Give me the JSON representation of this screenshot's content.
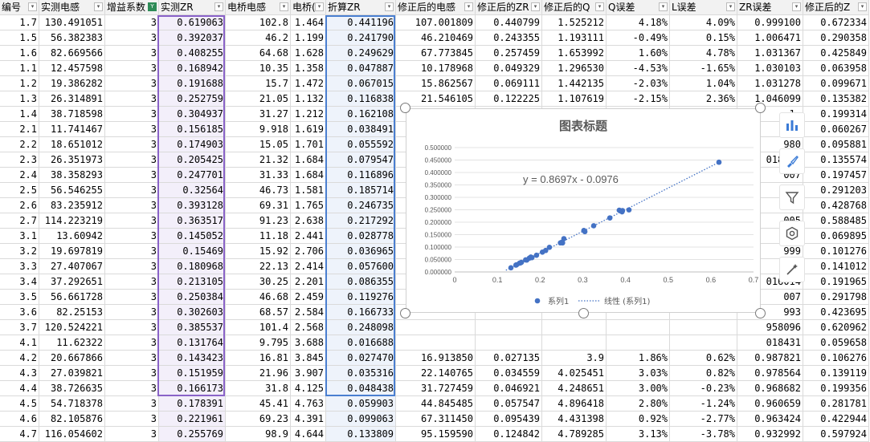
{
  "columns": [
    {
      "label": "编号",
      "filter": false
    },
    {
      "label": "实测电感",
      "filter": false
    },
    {
      "label": "增益系数",
      "filter": true
    },
    {
      "label": "实测ZR",
      "filter": false
    },
    {
      "label": "电桥电感",
      "filter": false
    },
    {
      "label": "电桥(",
      "filter": false
    },
    {
      "label": "折算ZR",
      "filter": false
    },
    {
      "label": "修正后的电感",
      "filter": false
    },
    {
      "label": "修正后的ZR",
      "filter": false
    },
    {
      "label": "修正后的Q",
      "filter": false
    },
    {
      "label": "Q误差",
      "filter": false
    },
    {
      "label": "L误差",
      "filter": false
    },
    {
      "label": "ZR误差",
      "filter": false
    },
    {
      "label": "修正后的Z",
      "filter": false
    }
  ],
  "rows": [
    [
      "1.7",
      "130.491051",
      "3",
      "0.619063",
      "102.8",
      "1.464",
      "0.441196",
      "107.001809",
      "0.440799",
      "1.525212",
      "4.18%",
      "4.09%",
      "0.999100",
      "0.672334"
    ],
    [
      "1.5",
      "56.382383",
      "3",
      "0.392037",
      "46.2",
      "1.199",
      "0.241790",
      "46.210469",
      "0.243355",
      "1.193111",
      "-0.49%",
      "0.15%",
      "1.006471",
      "0.290358"
    ],
    [
      "1.6",
      "82.669566",
      "3",
      "0.408255",
      "64.68",
      "1.628",
      "0.249629",
      "67.773845",
      "0.257459",
      "1.653992",
      "1.60%",
      "4.78%",
      "1.031367",
      "0.425849"
    ],
    [
      "1.1",
      "12.457598",
      "3",
      "0.168942",
      "10.35",
      "1.358",
      "0.047887",
      "10.178968",
      "0.049329",
      "1.296530",
      "-4.53%",
      "-1.65%",
      "1.030103",
      "0.063958"
    ],
    [
      "1.2",
      "19.386282",
      "3",
      "0.191688",
      "15.7",
      "1.472",
      "0.067015",
      "15.862567",
      "0.069111",
      "1.442135",
      "-2.03%",
      "1.04%",
      "1.031278",
      "0.099671"
    ],
    [
      "1.3",
      "26.314891",
      "3",
      "0.252759",
      "21.05",
      "1.132",
      "0.116838",
      "21.546105",
      "0.122225",
      "1.107619",
      "-2.15%",
      "2.36%",
      "1.046099",
      "0.135382"
    ],
    [
      "1.4",
      "38.718598",
      "3",
      "0.304937",
      "31.27",
      "1.212",
      "0.162108",
      "31.720866",
      "0.167604",
      "1.18",
      "-1.88%",
      "1.44%",
      "1.",
      "0.199314"
    ],
    [
      "2.1",
      "11.741467",
      "3",
      "0.156185",
      "9.918",
      "1.619",
      "0.038491",
      "",
      "",
      "",
      "",
      "",
      "",
      "0.060267"
    ],
    [
      "2.2",
      "18.651012",
      "3",
      "0.174903",
      "15.05",
      "1.701",
      "0.055592",
      "",
      "",
      "",
      "",
      "",
      "",
      "0.095881"
    ],
    [
      "2.3",
      "26.351973",
      "3",
      "0.205425",
      "21.32",
      "1.684",
      "0.079547",
      "",
      "",
      "",
      "",
      "",
      "",
      "0.135574"
    ],
    [
      "2.4",
      "38.358293",
      "3",
      "0.247701",
      "31.33",
      "1.684",
      "0.116896",
      "",
      "",
      "",
      "",
      "",
      "",
      "0.197457"
    ],
    [
      "2.5",
      "56.546255",
      "3",
      "0.32564",
      "46.73",
      "1.581",
      "0.185714",
      "",
      "",
      "",
      "",
      "",
      "",
      "0.291203"
    ],
    [
      "2.6",
      "83.235912",
      "3",
      "0.393128",
      "69.31",
      "1.765",
      "0.246735",
      "",
      "",
      "",
      "",
      "",
      "",
      "0.428768"
    ],
    [
      "2.7",
      "114.223219",
      "3",
      "0.363517",
      "91.23",
      "2.638",
      "0.217292",
      "",
      "",
      "",
      "",
      "",
      "",
      "0.588485"
    ],
    [
      "3.1",
      "13.60942",
      "3",
      "0.145052",
      "11.18",
      "2.441",
      "0.028778",
      "",
      "",
      "",
      "",
      "",
      "",
      "0.069895"
    ],
    [
      "3.2",
      "19.697819",
      "3",
      "0.15469",
      "15.92",
      "2.706",
      "0.036965",
      "",
      "",
      "",
      "",
      "",
      "",
      "0.101276"
    ],
    [
      "3.3",
      "27.407067",
      "3",
      "0.180968",
      "22.13",
      "2.414",
      "0.057600",
      "",
      "",
      "",
      "",
      "",
      "",
      "0.141012"
    ],
    [
      "3.4",
      "37.292651",
      "3",
      "0.213105",
      "30.25",
      "2.201",
      "0.086355",
      "",
      "",
      "",
      "",
      "",
      "",
      "0.191965"
    ],
    [
      "3.5",
      "56.661728",
      "3",
      "0.250384",
      "46.68",
      "2.459",
      "0.119276",
      "",
      "",
      "",
      "",
      "",
      "",
      "0.291798"
    ],
    [
      "3.6",
      "82.25153",
      "3",
      "0.302603",
      "68.57",
      "2.584",
      "0.166733",
      "",
      "",
      "",
      "",
      "",
      "",
      "0.423695"
    ],
    [
      "3.7",
      "120.524221",
      "3",
      "0.385537",
      "101.4",
      "2.568",
      "0.248098",
      "",
      "",
      "",
      "",
      "",
      "",
      "0.620962"
    ],
    [
      "4.1",
      "11.62322",
      "3",
      "0.131764",
      "9.795",
      "3.688",
      "0.016688",
      "",
      "",
      "",
      "",
      "",
      "",
      "0.059658"
    ],
    [
      "4.2",
      "20.667866",
      "3",
      "0.143423",
      "16.81",
      "3.845",
      "0.027470",
      "16.913850",
      "0.027135",
      "3.9",
      "1.86%",
      "0.62%",
      "0.987821",
      "0.106276"
    ],
    [
      "4.3",
      "27.039821",
      "3",
      "0.151959",
      "21.96",
      "3.907",
      "0.035316",
      "22.140765",
      "0.034559",
      "4.025451",
      "3.03%",
      "0.82%",
      "0.978564",
      "0.139119"
    ],
    [
      "4.4",
      "38.726635",
      "3",
      "0.166173",
      "31.8",
      "4.125",
      "0.048438",
      "31.727459",
      "0.046921",
      "4.248651",
      "3.00%",
      "-0.23%",
      "0.968682",
      "0.199356"
    ],
    [
      "4.5",
      "54.718378",
      "3",
      "0.178391",
      "45.41",
      "4.763",
      "0.059903",
      "44.845485",
      "0.057547",
      "4.896418",
      "2.80%",
      "-1.24%",
      "0.960659",
      "0.281781"
    ],
    [
      "4.6",
      "82.105876",
      "3",
      "0.221961",
      "69.23",
      "4.391",
      "0.099063",
      "67.311450",
      "0.095439",
      "4.431398",
      "0.92%",
      "-2.77%",
      "0.963424",
      "0.422944"
    ],
    [
      "4.7",
      "116.054602",
      "3",
      "0.255769",
      "98.9",
      "4.644",
      "0.133809",
      "95.159590",
      "0.124842",
      "4.789285",
      "3.13%",
      "-3.78%",
      "0.932992",
      "0.597924"
    ]
  ],
  "partial_rows": {
    "7": [
      "",
      "",
      "",
      "",
      "",
      "",
      "",
      "",
      "",
      "",
      "",
      "",
      "993",
      "0.060267"
    ],
    "8": [
      "",
      "",
      "",
      "",
      "",
      "",
      "",
      "",
      "",
      "",
      "",
      "",
      "980",
      "0.095881"
    ],
    "9": [
      "",
      "",
      "",
      "",
      "",
      "",
      "",
      "",
      "",
      "",
      "",
      "",
      "018994",
      "0.135574"
    ],
    "10": [
      "",
      "",
      "",
      "",
      "",
      "",
      "",
      "",
      "",
      "",
      "",
      "",
      "007",
      "0.197457"
    ],
    "11": [
      "",
      "",
      "",
      "",
      "",
      "",
      "",
      "",
      "",
      "",
      "",
      "",
      "999",
      "0.291203"
    ],
    "12": [
      "",
      "",
      "",
      "",
      "",
      "",
      "",
      "",
      "",
      "",
      "",
      "",
      "990",
      "0.428768"
    ],
    "13": [
      "",
      "",
      "",
      "",
      "",
      "",
      "",
      "",
      "",
      "",
      "",
      "",
      "005",
      "0.588485"
    ],
    "14": [
      "",
      "",
      "",
      "",
      "",
      "",
      "",
      "",
      "",
      "",
      "",
      "",
      "992",
      "0.069895"
    ],
    "15": [
      "",
      "",
      "",
      "",
      "",
      "",
      "",
      "",
      "",
      "",
      "",
      "",
      "999",
      "0.101276"
    ],
    "16": [
      "",
      "",
      "",
      "",
      "",
      "",
      "",
      "",
      "",
      "",
      "",
      "",
      "037",
      "0.141012"
    ],
    "17": [
      "",
      "",
      "",
      "",
      "",
      "",
      "",
      "",
      "",
      "",
      "",
      "",
      "016014",
      "0.191965"
    ],
    "18": [
      "",
      "",
      "",
      "",
      "",
      "",
      "",
      "",
      "",
      "",
      "",
      "",
      "007",
      "0.291798"
    ],
    "19": [
      "",
      "",
      "",
      "",
      "",
      "",
      "",
      "",
      "",
      "",
      "",
      "",
      "993",
      "0.423695"
    ],
    "20": [
      "",
      "",
      "",
      "",
      "",
      "",
      "",
      "",
      "",
      "",
      "",
      "",
      "958096",
      "0.620962"
    ],
    "21": [
      "",
      "",
      "",
      "",
      "",
      "",
      "",
      "",
      "",
      "",
      "",
      "",
      "018431",
      "0.059658"
    ]
  },
  "chart": {
    "title": "图表标题",
    "equation": "y = 0.8697x - 0.0976",
    "legend_series": "系列1",
    "legend_trend": "线性 (系列1)",
    "series_color": "#4472c4"
  },
  "chart_data": {
    "type": "scatter",
    "title": "图表标题",
    "xlim": [
      0,
      0.7
    ],
    "ylim": [
      0,
      0.5
    ],
    "xticks": [
      "0",
      "0.1",
      "0.2",
      "0.3",
      "0.4",
      "0.5",
      "0.6",
      "0.7"
    ],
    "yticks": [
      "0.000000",
      "0.050000",
      "0.100000",
      "0.150000",
      "0.200000",
      "0.250000",
      "0.300000",
      "0.350000",
      "0.400000",
      "0.450000",
      "0.500000"
    ],
    "series": [
      {
        "name": "系列1",
        "x": [
          0.619063,
          0.392037,
          0.408255,
          0.168942,
          0.191688,
          0.252759,
          0.304937,
          0.156185,
          0.174903,
          0.205425,
          0.247701,
          0.32564,
          0.393128,
          0.363517,
          0.145052,
          0.15469,
          0.180968,
          0.213105,
          0.250384,
          0.302603,
          0.385537,
          0.131764,
          0.143423,
          0.151959,
          0.166173,
          0.178391,
          0.221961,
          0.255769
        ],
        "y": [
          0.441196,
          0.24179,
          0.249629,
          0.047887,
          0.067015,
          0.116838,
          0.162108,
          0.038491,
          0.055592,
          0.079547,
          0.116896,
          0.185714,
          0.246735,
          0.217292,
          0.028778,
          0.036965,
          0.0576,
          0.086355,
          0.119276,
          0.166733,
          0.248098,
          0.016688,
          0.02747,
          0.035316,
          0.048438,
          0.059903,
          0.099063,
          0.133809
        ]
      }
    ],
    "trendline": {
      "slope": 0.8697,
      "intercept": -0.0976,
      "style": "dotted"
    },
    "legend": "bottom"
  }
}
